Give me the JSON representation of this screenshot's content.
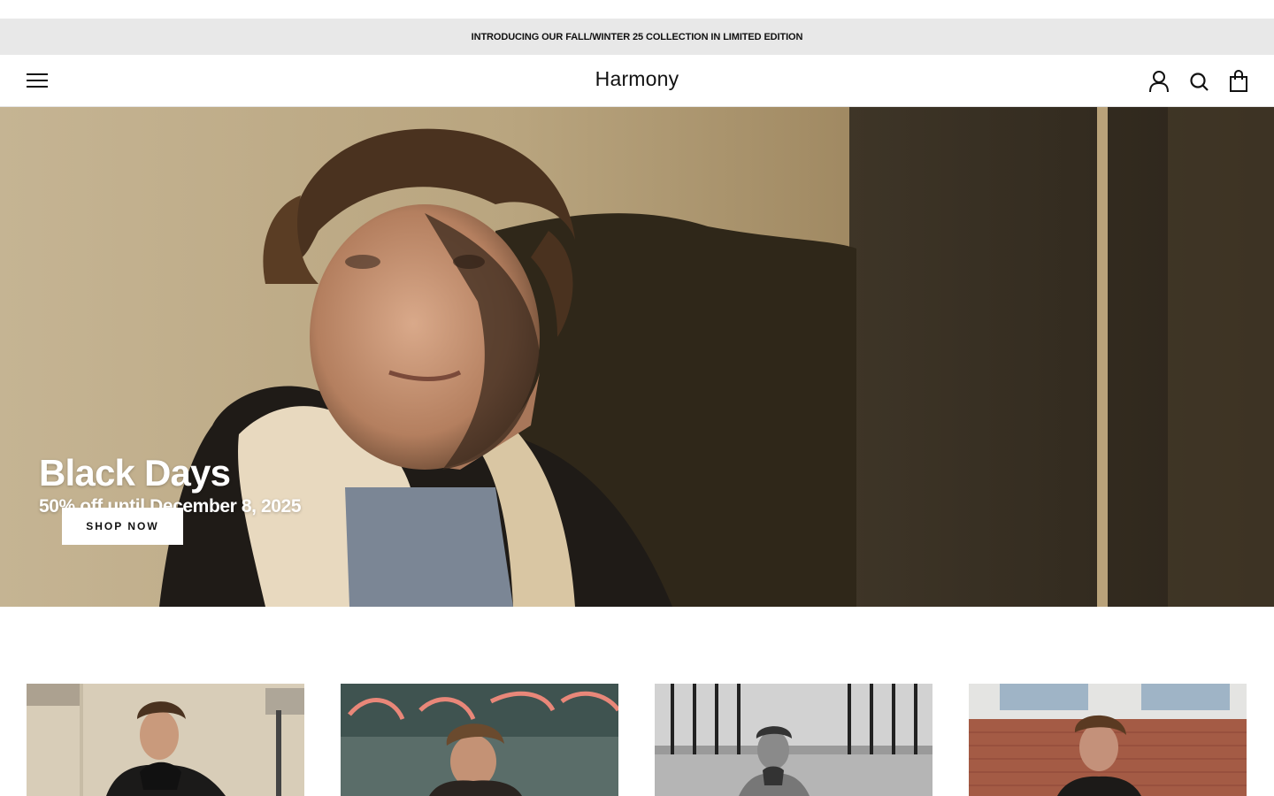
{
  "announcement": {
    "text": "INTRODUCING OUR FALL/WINTER 25 COLLECTION IN LIMITED EDITION"
  },
  "header": {
    "logo": "Harmony",
    "icons": {
      "menu": "hamburger-menu-icon",
      "account": "user-icon",
      "search": "search-icon",
      "cart": "shopping-bag-icon"
    }
  },
  "hero": {
    "title": "Black Days",
    "subtitle": "50% off until December 8, 2025",
    "cta_label": "SHOP NOW"
  },
  "collections": {
    "cards": [
      {
        "scene": "man in black scarf against stone wall"
      },
      {
        "scene": "man under red neon sign"
      },
      {
        "scene": "black and white man by iron fence"
      },
      {
        "scene": "man in front of brick building"
      }
    ]
  },
  "colors": {
    "announcement_bg": "#e8e8e8",
    "button_bg": "#ffffff",
    "text": "#111111"
  }
}
